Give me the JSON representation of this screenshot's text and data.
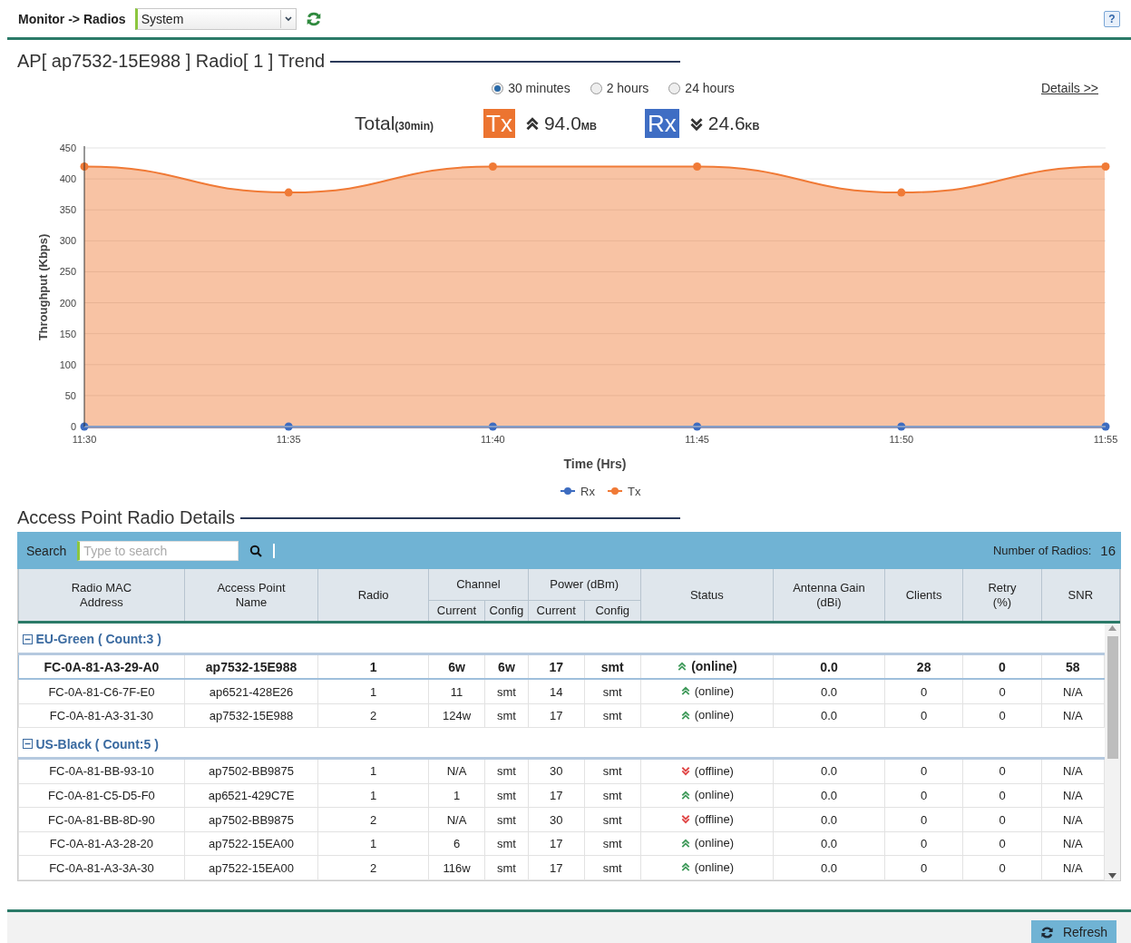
{
  "breadcrumb": "Monitor -> Radios",
  "scope_select": {
    "value": "System"
  },
  "help": "?",
  "trend": {
    "title": "AP[ ap7532-15E988 ] Radio[ 1 ] Trend",
    "ranges": [
      {
        "label": "30 minutes",
        "selected": true
      },
      {
        "label": "2 hours",
        "selected": false
      },
      {
        "label": "24 hours",
        "selected": false
      }
    ],
    "details_link": "Details >>",
    "total": {
      "label": "Total",
      "period": "(30min)",
      "tx": {
        "badge": "Tx",
        "value": "94.0",
        "unit": "MB"
      },
      "rx": {
        "badge": "Rx",
        "value": "24.6",
        "unit": "KB"
      }
    },
    "chart_data": {
      "type": "area",
      "xlabel": "Time (Hrs)",
      "ylabel": "Throughput (Kbps)",
      "categories": [
        "11:30",
        "11:35",
        "11:40",
        "11:45",
        "11:50",
        "11:55"
      ],
      "series": [
        {
          "name": "Rx",
          "color": "#3d6cc0",
          "values": [
            0,
            0,
            0,
            0,
            0,
            0
          ]
        },
        {
          "name": "Tx",
          "color": "#f07a36",
          "values": [
            420,
            378,
            420,
            420,
            378,
            420
          ]
        }
      ],
      "ylim": [
        0,
        450
      ],
      "grid": true,
      "legend": "bottom",
      "yticks": [
        0,
        50,
        100,
        150,
        200,
        250,
        300,
        350,
        400,
        450
      ]
    }
  },
  "radio_details": {
    "title": "Access Point Radio Details",
    "search": {
      "label": "Search",
      "placeholder": "Type to search"
    },
    "count_label": "Number of Radios:",
    "count": "16",
    "columns": [
      {
        "label": "Radio MAC\nAddress"
      },
      {
        "label": "Access Point\nName"
      },
      {
        "label": "Radio"
      },
      {
        "label": "Channel",
        "sub": [
          "Current",
          "Config"
        ]
      },
      {
        "label": "Power (dBm)",
        "sub": [
          "Current",
          "Config"
        ]
      },
      {
        "label": "Status"
      },
      {
        "label": "Antenna Gain\n(dBi)"
      },
      {
        "label": "Clients"
      },
      {
        "label": "Retry\n(%)"
      },
      {
        "label": "SNR"
      }
    ],
    "groups": [
      {
        "name": "EU-Green ( Count:3 )",
        "expanded": true,
        "rows": [
          {
            "selected": true,
            "online": true,
            "cells": [
              "FC-0A-81-A3-29-A0",
              "ap7532-15E988",
              "1",
              "6w",
              "6w",
              "17",
              "smt",
              "(online)",
              "0.0",
              "28",
              "0",
              "58"
            ]
          },
          {
            "selected": false,
            "online": true,
            "cells": [
              "FC-0A-81-C6-7F-E0",
              "ap6521-428E26",
              "1",
              "11",
              "smt",
              "14",
              "smt",
              "(online)",
              "0.0",
              "0",
              "0",
              "N/A"
            ]
          },
          {
            "selected": false,
            "online": true,
            "cells": [
              "FC-0A-81-A3-31-30",
              "ap7532-15E988",
              "2",
              "124w",
              "smt",
              "17",
              "smt",
              "(online)",
              "0.0",
              "0",
              "0",
              "N/A"
            ]
          }
        ]
      },
      {
        "name": "US-Black ( Count:5 )",
        "expanded": true,
        "rows": [
          {
            "selected": false,
            "online": false,
            "cells": [
              "FC-0A-81-BB-93-10",
              "ap7502-BB9875",
              "1",
              "N/A",
              "smt",
              "30",
              "smt",
              "(offline)",
              "0.0",
              "0",
              "0",
              "N/A"
            ]
          },
          {
            "selected": false,
            "online": true,
            "cells": [
              "FC-0A-81-C5-D5-F0",
              "ap6521-429C7E",
              "1",
              "1",
              "smt",
              "17",
              "smt",
              "(online)",
              "0.0",
              "0",
              "0",
              "N/A"
            ]
          },
          {
            "selected": false,
            "online": false,
            "cells": [
              "FC-0A-81-BB-8D-90",
              "ap7502-BB9875",
              "2",
              "N/A",
              "smt",
              "30",
              "smt",
              "(offline)",
              "0.0",
              "0",
              "0",
              "N/A"
            ]
          },
          {
            "selected": false,
            "online": true,
            "cells": [
              "FC-0A-81-A3-28-20",
              "ap7522-15EA00",
              "1",
              "6",
              "smt",
              "17",
              "smt",
              "(online)",
              "0.0",
              "0",
              "0",
              "N/A"
            ]
          },
          {
            "selected": false,
            "online": true,
            "cells": [
              "FC-0A-81-A3-3A-30",
              "ap7522-15EA00",
              "2",
              "116w",
              "smt",
              "17",
              "smt",
              "(online)",
              "0.0",
              "0",
              "0",
              "N/A"
            ]
          }
        ]
      }
    ]
  },
  "refresh_button": "Refresh"
}
